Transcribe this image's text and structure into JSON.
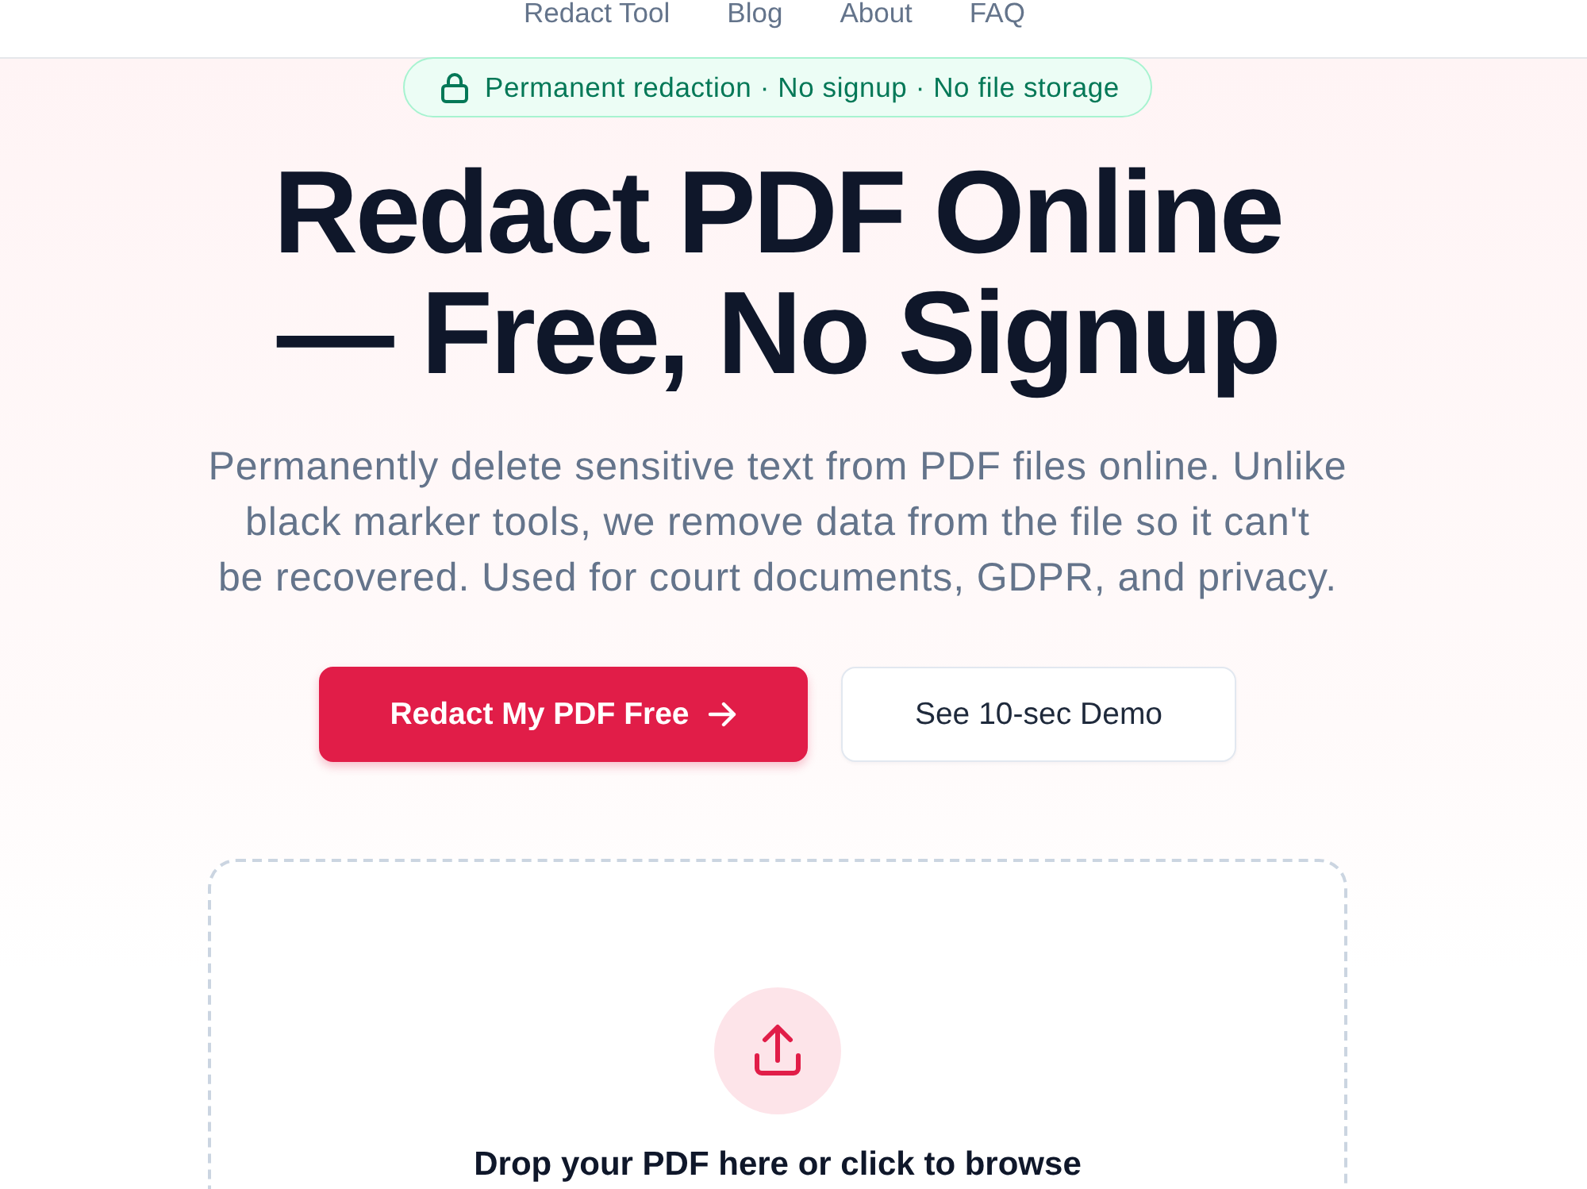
{
  "nav": {
    "links": [
      "Redact Tool",
      "Blog",
      "About",
      "FAQ"
    ]
  },
  "hero": {
    "badge": "Permanent redaction · No signup · No file storage",
    "title_lines": [
      "Redact PDF Online",
      "— Free, No Signup"
    ],
    "subtitle_lines": [
      "Permanently delete sensitive text from PDF files online. Unlike",
      "black marker tools, we remove data from the file so it can't",
      "be recovered. Used for court documents, GDPR, and privacy."
    ],
    "buttons": [
      {
        "label": "Redact My PDF Free",
        "kind": "primary"
      },
      {
        "label": "See 10-sec Demo",
        "kind": "secondary"
      }
    ]
  },
  "upload": {
    "prompt": "Drop your PDF here or click to browse"
  }
}
